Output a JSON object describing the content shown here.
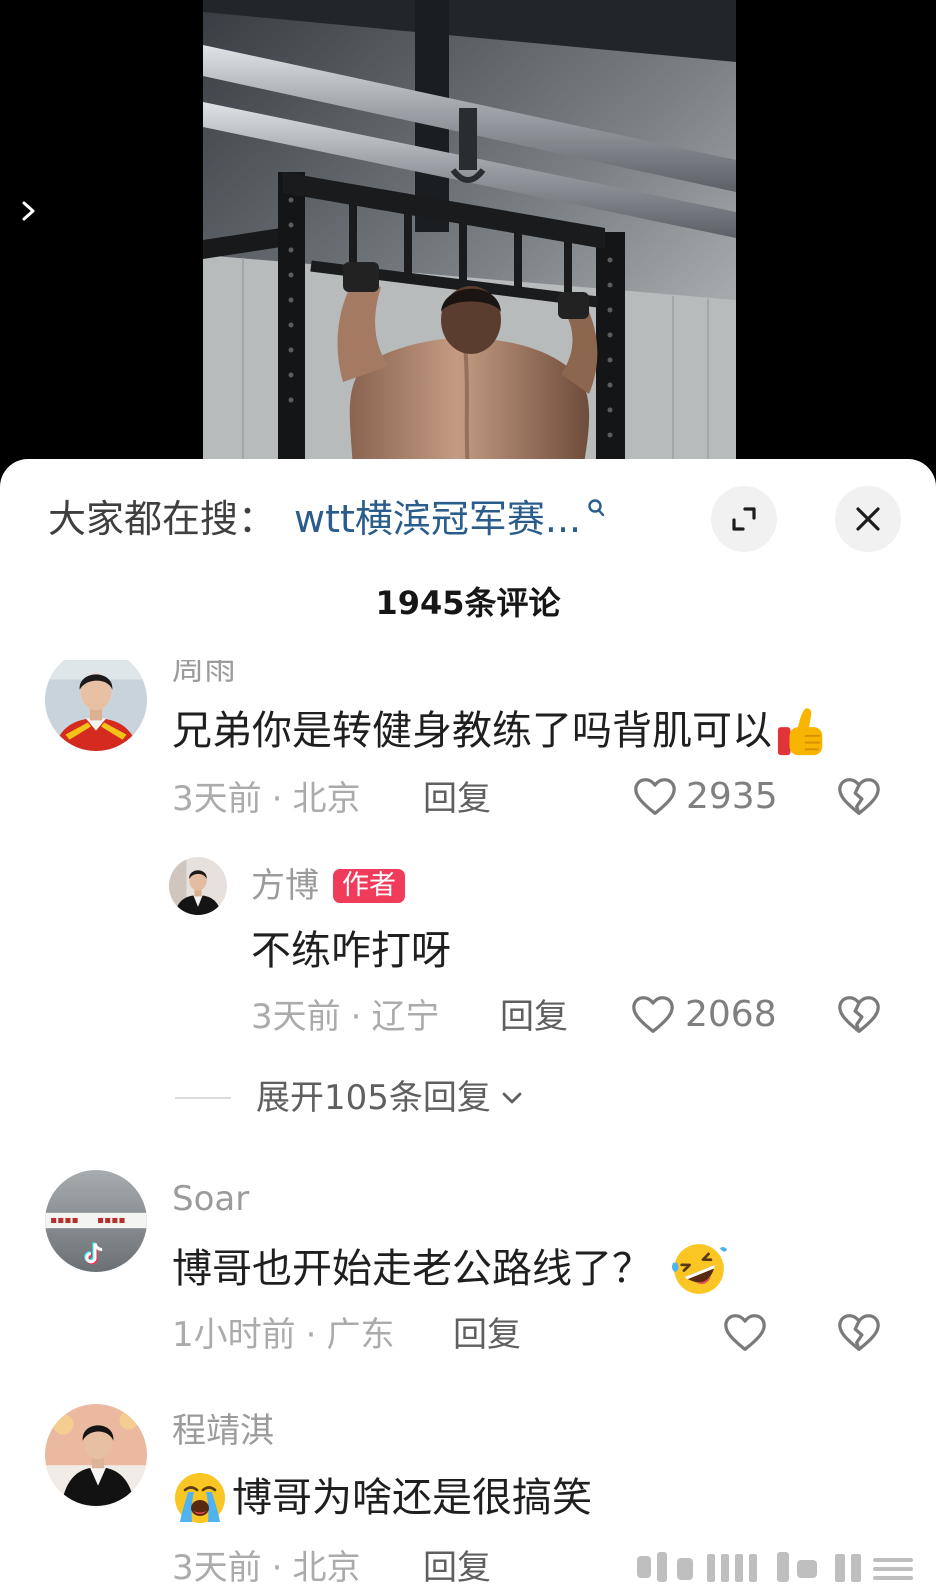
{
  "video": {
    "next_icon": "chevron-right-icon"
  },
  "search_bar": {
    "prefix": "大家都在搜：",
    "query": "wtt横滨冠军赛...",
    "search_icon": "search-icon",
    "expand_icon": "expand-icon",
    "close_icon": "close-icon"
  },
  "comments_header": {
    "title": "1945条评论"
  },
  "ui": {
    "dot": "·",
    "like_icon": "heart-outline-icon",
    "dislike_icon": "broken-heart-icon",
    "expand_chevron": "chevron-down-icon"
  },
  "colors": {
    "search_query": "#2a5c8c",
    "author_badge": "#f03c5a",
    "meta_gray": "#ababab"
  },
  "comments": [
    {
      "author": "周雨",
      "text": "兄弟你是转健身教练了吗背肌可以",
      "emoji": "thumbs-up-emoji",
      "time": "3天前",
      "location": "北京",
      "reply_label": "回复",
      "likes": "2935",
      "replies": [
        {
          "author": "方博",
          "badge": "作者",
          "text": "不练咋打呀",
          "time": "3天前",
          "location": "辽宁",
          "reply_label": "回复",
          "likes": "2068"
        }
      ],
      "expand_label": "展开105条回复"
    },
    {
      "author": "Soar",
      "text": "博哥也开始走老公路线了？",
      "emoji": "rofl-emoji",
      "time": "1小时前",
      "location": "广东",
      "reply_label": "回复"
    },
    {
      "author": "程靖淇",
      "text": "博哥为啥还是很搞笑",
      "emoji": "loudly-crying-emoji",
      "time": "3天前",
      "location": "北京",
      "reply_label": "回复"
    }
  ]
}
